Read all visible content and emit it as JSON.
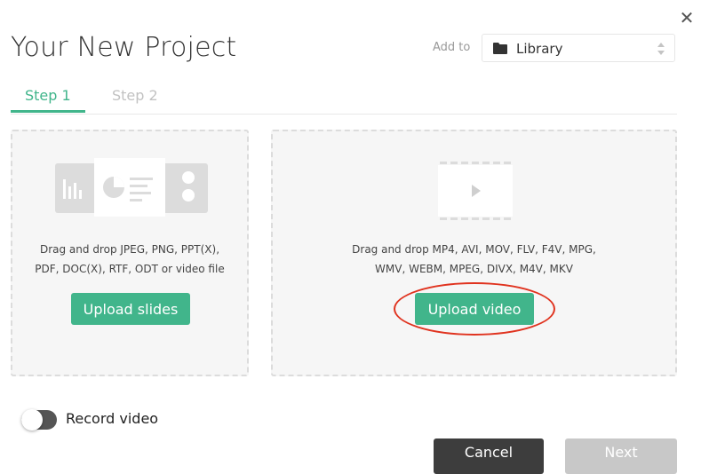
{
  "dialog": {
    "title": "Your New Project",
    "close_icon": "close-icon",
    "close_glyph": "✕"
  },
  "add_to": {
    "label": "Add to",
    "selected": "Library",
    "icon": "folder-icon"
  },
  "tabs": [
    {
      "label": "Step 1",
      "active": true
    },
    {
      "label": "Step 2",
      "active": false
    }
  ],
  "slides_panel": {
    "line1": "Drag and drop JPEG, PNG, PPT(X),",
    "line2": "PDF, DOC(X), RTF, ODT or video file",
    "button": "Upload slides",
    "icon": "slides-illustration-icon"
  },
  "video_panel": {
    "line1": "Drag and drop MP4, AVI, MOV, FLV, F4V, MPG,",
    "line2": "WMV, WEBM, MPEG, DIVX, M4V, MKV",
    "button": "Upload video",
    "icon": "video-play-icon"
  },
  "record": {
    "label": "Record video",
    "enabled": false
  },
  "footer": {
    "cancel": "Cancel",
    "next": "Next"
  },
  "colors": {
    "accent": "#41b58b",
    "annotation": "#e0331f",
    "cancel_bg": "#3d3d3d",
    "next_disabled_bg": "#c8c8c8"
  }
}
